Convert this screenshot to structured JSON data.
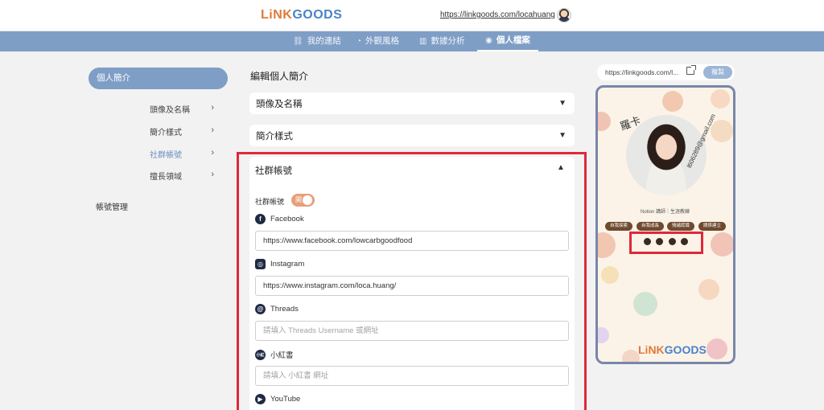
{
  "header": {
    "logo_prefix": "LiNK",
    "logo_suffix": "GOODS",
    "user_url": "https://linkgoods.com/locahuang"
  },
  "nav": {
    "tabs": [
      {
        "label": "我的連結",
        "icon": "link-icon"
      },
      {
        "label": "外觀風格",
        "icon": "palette-icon"
      },
      {
        "label": "數據分析",
        "icon": "chart-icon"
      },
      {
        "label": "個人檔案",
        "icon": "user-icon",
        "active": true
      }
    ]
  },
  "sidebar": {
    "active_label": "個人簡介",
    "items": [
      {
        "label": "頭像及名稱"
      },
      {
        "label": "簡介樣式"
      },
      {
        "label": "社群帳號",
        "active": true
      },
      {
        "label": "擅長領域"
      }
    ],
    "account_label": "帳號管理"
  },
  "main": {
    "title": "編輯個人簡介",
    "sections": [
      {
        "label": "頭像及名稱"
      },
      {
        "label": "簡介樣式"
      }
    ],
    "social": {
      "heading": "社群帳號",
      "toggle_label": "社群帳號",
      "toggle_text": "開",
      "toggle_on": true,
      "fields": [
        {
          "label": "Facebook",
          "icon": "facebook-icon",
          "value": "https://www.facebook.com/lowcarbgoodfood",
          "placeholder": ""
        },
        {
          "label": "Instagram",
          "icon": "instagram-icon",
          "value": "https://www.instagram.com/loca.huang/",
          "placeholder": ""
        },
        {
          "label": "Threads",
          "icon": "threads-icon",
          "value": "",
          "placeholder": "請填入 Threads Username 或網址"
        },
        {
          "label": "小紅書",
          "icon": "xiaohongshu-icon",
          "value": "",
          "placeholder": "請填入 小紅書 網址"
        },
        {
          "label": "YouTube",
          "icon": "youtube-icon",
          "value": "",
          "placeholder": ""
        }
      ]
    }
  },
  "preview": {
    "url": "https://linkgoods.com/l...",
    "copy_label": "複製",
    "nickname": "羅卡",
    "email": "l606289@gmail.com",
    "subtitle": "Notion 講師｜生涯教練",
    "tags": [
      "自我探索",
      "自我成長",
      "情緒認識",
      "關係建立"
    ],
    "icons": [
      "facebook-icon",
      "instagram-icon",
      "threads-icon",
      "xiaohongshu-icon"
    ],
    "brand_prefix": "LiNK",
    "brand_suffix": "GOODS",
    "colors": {
      "accent_blue": "#7e9ec6",
      "tag_brown": "#6f4a2e",
      "highlight_red": "#e0283a",
      "toggle_orange": "#e6a07a"
    }
  }
}
